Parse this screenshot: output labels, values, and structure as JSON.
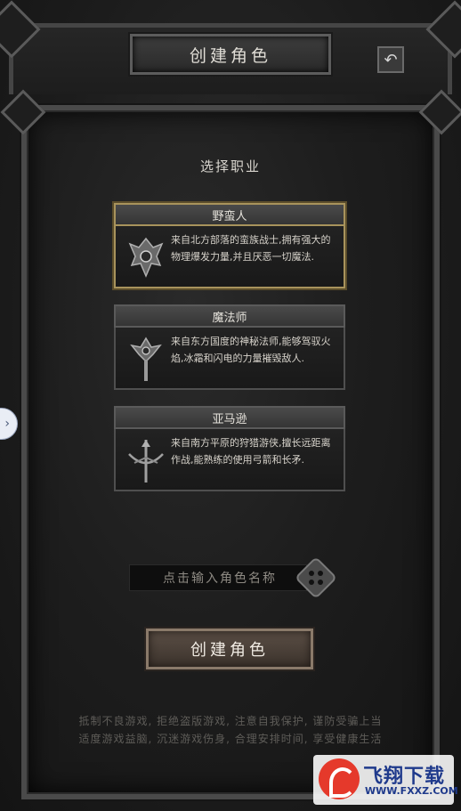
{
  "header": {
    "title": "创建角色",
    "back_icon": "↶"
  },
  "select_class": {
    "title": "选择职业",
    "classes": [
      {
        "name": "野蛮人",
        "description": "来自北方部落的蛮族战士,拥有强大的物理爆发力量,并且厌恶一切魔法.",
        "icon": "barbarian-emblem",
        "selected": true
      },
      {
        "name": "魔法师",
        "description": "来自东方国度的神秘法师,能够驾驭火焰,冰霜和闪电的力量摧毁敌人.",
        "icon": "mage-emblem",
        "selected": false
      },
      {
        "name": "亚马逊",
        "description": "来自南方平原的狩猎游侠,擅长远距离作战,能熟练的使用弓箭和长矛.",
        "icon": "amazon-emblem",
        "selected": false
      }
    ]
  },
  "name_input": {
    "placeholder": "点击输入角色名称",
    "value": ""
  },
  "create_button": {
    "label": "创建角色"
  },
  "notice": {
    "line1": "抵制不良游戏, 拒绝盗版游戏, 注意自我保护, 谨防受骗上当",
    "line2": "适度游戏益脑, 沉迷游戏伤身, 合理安排时间, 享受健康生活"
  },
  "side_tab": {
    "icon": "›"
  },
  "watermark": {
    "brand": "飞翔下载",
    "url": "WWW.FXXZ.COM"
  },
  "colors": {
    "selected_border": "#a8935c",
    "text_light": "#e0ddd6",
    "notice_text": "#5e5c58"
  }
}
